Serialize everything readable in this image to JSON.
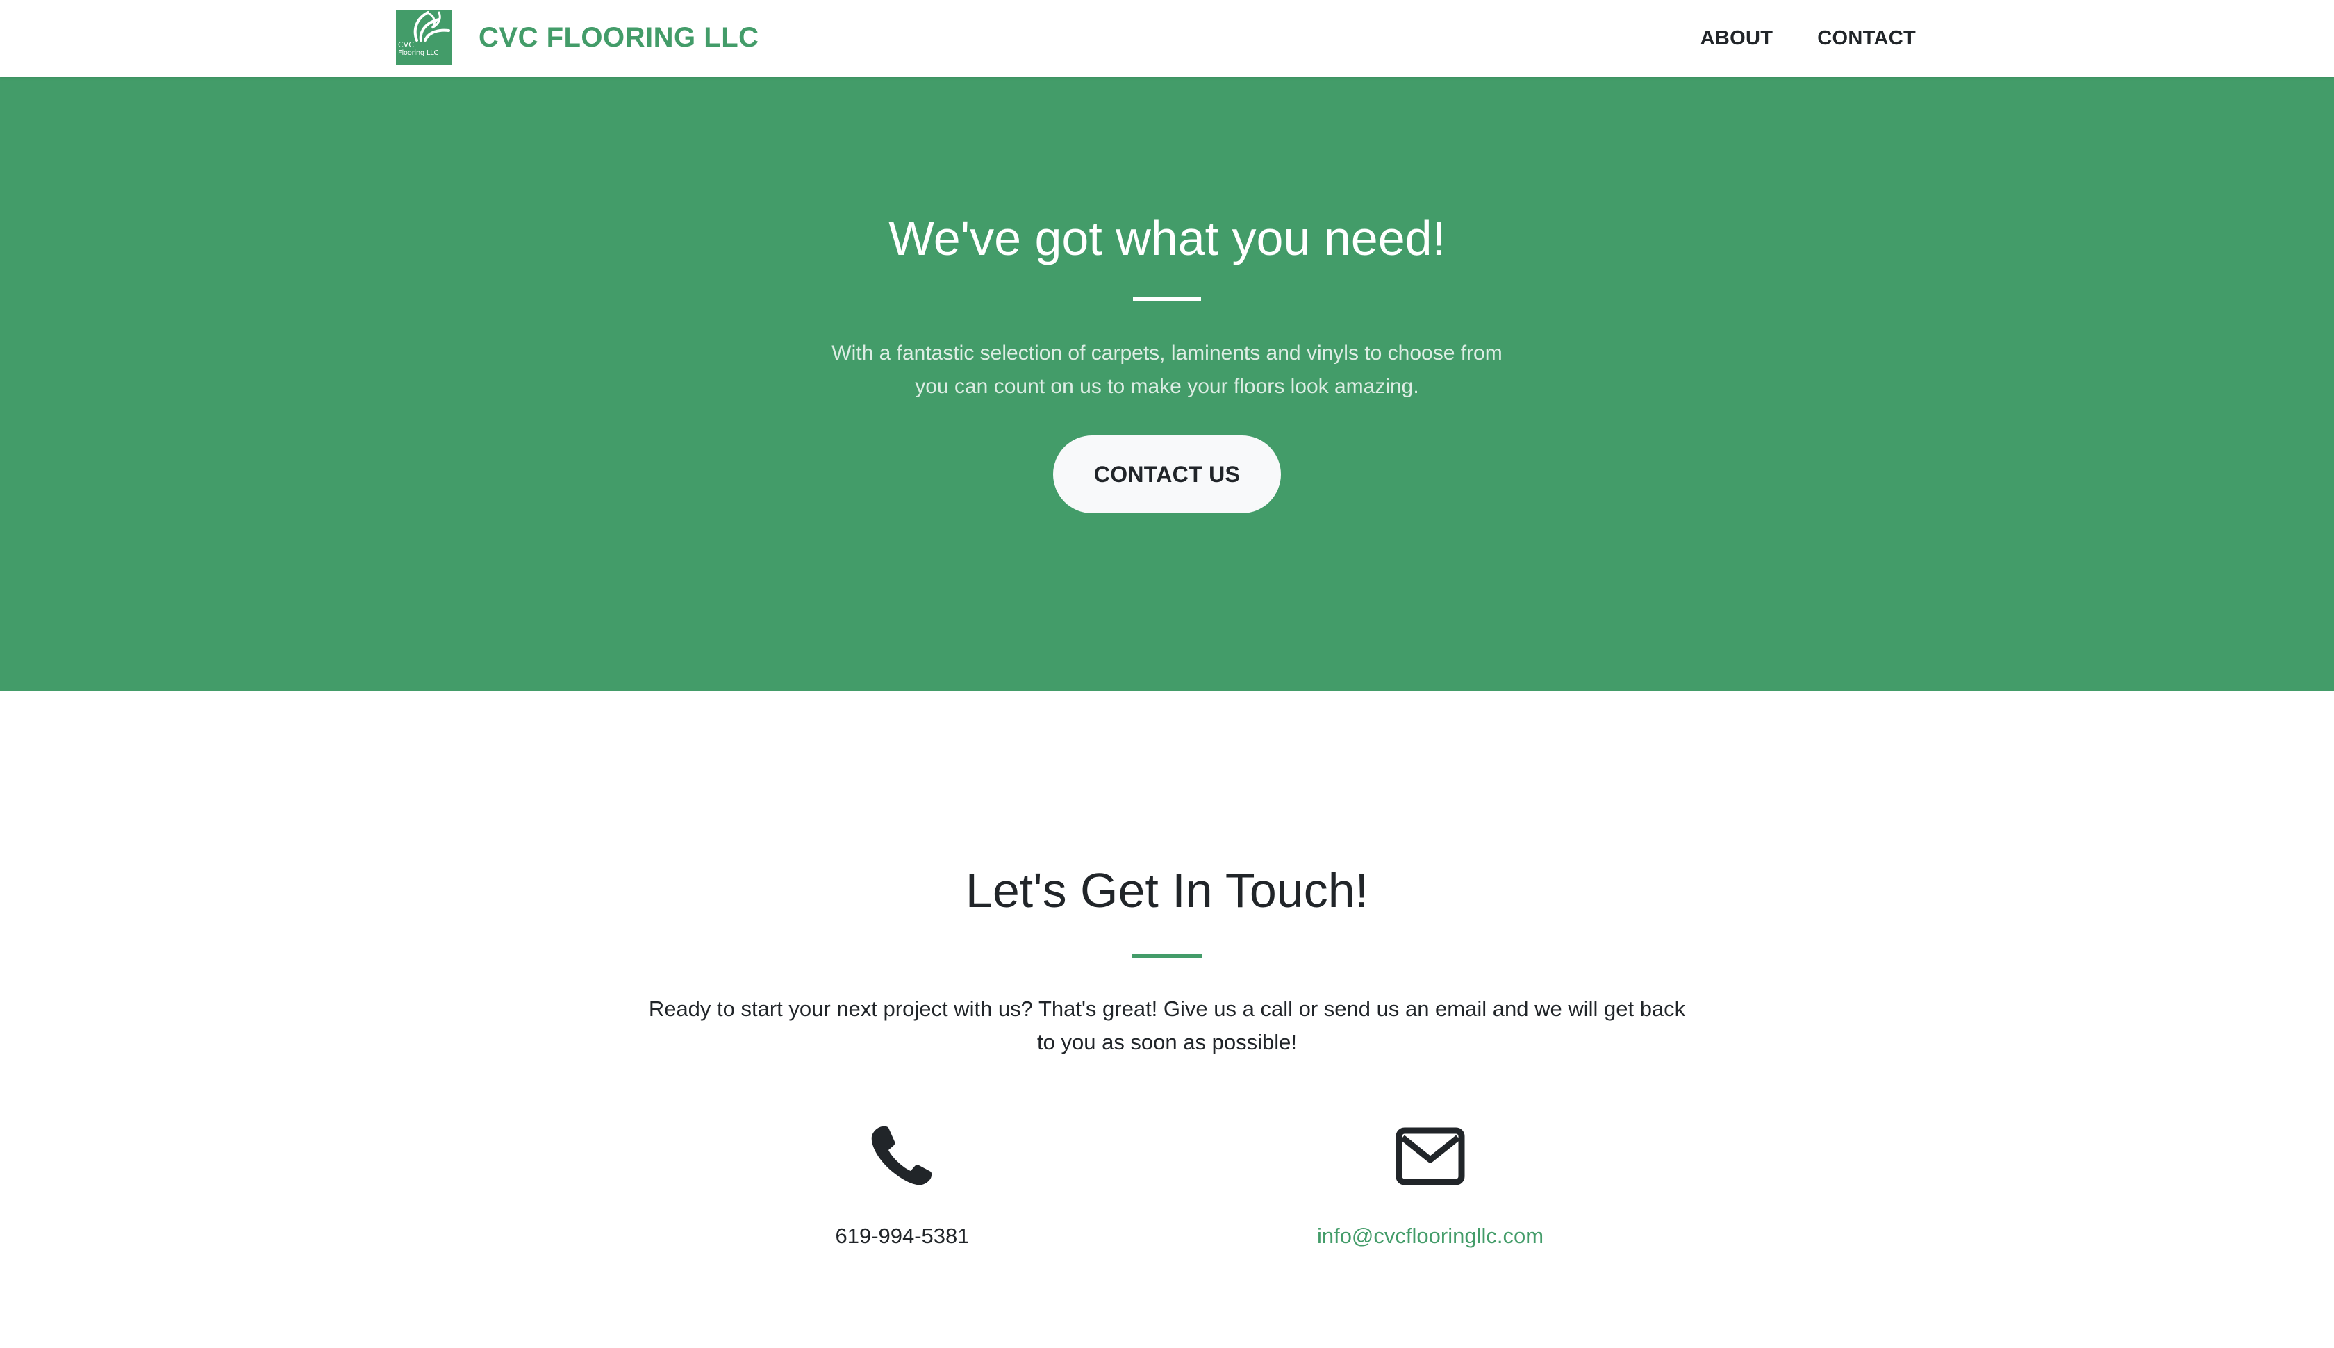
{
  "colors": {
    "brand_green": "#439c69",
    "text_dark": "#212529",
    "button_light": "#f8f9fa"
  },
  "navbar": {
    "logo": {
      "icon": "leaf-swirl-logo-icon",
      "line1": "CVC",
      "line2": "Flooring LLC"
    },
    "brand": "CVC FLOORING LLC",
    "links": [
      {
        "label": "ABOUT"
      },
      {
        "label": "CONTACT"
      }
    ]
  },
  "hero": {
    "heading": "We've got what you need!",
    "text": "With a fantastic selection of carpets, laminents and vinyls to choose from you can count on us to make your floors look amazing.",
    "button_label": "CONTACT US"
  },
  "contact": {
    "heading": "Let's Get In Touch!",
    "text": "Ready to start your next project with us? That's great! Give us a call or send us an email and we will get back to you as soon as possible!",
    "phone": {
      "icon": "phone-icon",
      "value": "619-994-5381"
    },
    "email": {
      "icon": "envelope-icon",
      "value": "info@cvcflooringllc.com"
    }
  }
}
